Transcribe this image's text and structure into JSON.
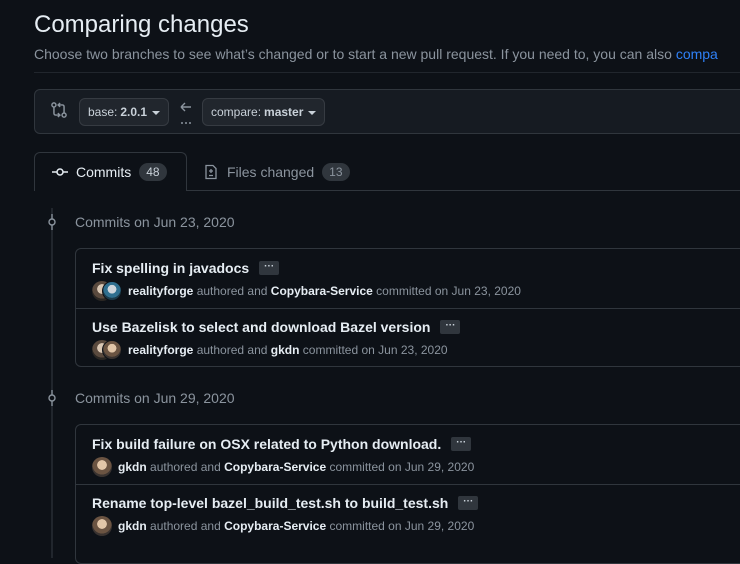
{
  "header": {
    "title": "Comparing changes",
    "subtitle": "Choose two branches to see what’s changed or to start a new pull request. If you need to, you can also",
    "subtitle_link": "compa"
  },
  "range": {
    "base_prefix": "base:",
    "base_branch": "2.0.1",
    "compare_prefix": "compare:",
    "compare_branch": "master"
  },
  "tabs": [
    {
      "label": "Commits",
      "count": "48"
    },
    {
      "label": "Files changed",
      "count": "13"
    }
  ],
  "groups": [
    {
      "label": "Commits on Jun 23, 2020",
      "commits": [
        {
          "title": "Fix spelling in javadocs",
          "author": "realityforge",
          "authored_text": "authored and",
          "committer": "Copybara-Service",
          "committed_text": "committed on Jun 23, 2020"
        },
        {
          "title": "Use Bazelisk to select and download Bazel version",
          "author": "realityforge",
          "authored_text": "authored and",
          "committer": "gkdn",
          "committed_text": "committed on Jun 23, 2020"
        }
      ]
    },
    {
      "label": "Commits on Jun 29, 2020",
      "commits": [
        {
          "title": "Fix build failure on OSX related to Python download.",
          "author": "gkdn",
          "authored_text": "authored and",
          "committer": "Copybara-Service",
          "committed_text": "committed on Jun 29, 2020"
        },
        {
          "title": "Rename top-level bazel_build_test.sh to build_test.sh",
          "author": "gkdn",
          "authored_text": "authored and",
          "committer": "Copybara-Service",
          "committed_text": "committed on Jun 29, 2020"
        }
      ]
    }
  ],
  "ellipsis_label": "···",
  "colors": {
    "background": "#0d1117",
    "link": "#2f81f7",
    "border": "#30363d"
  }
}
